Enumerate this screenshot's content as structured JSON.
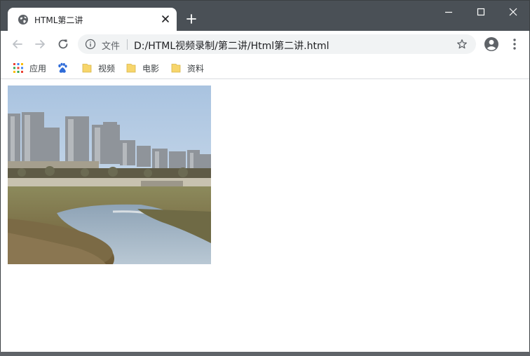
{
  "tab": {
    "title": "HTML第二讲",
    "favicon": "globe-icon"
  },
  "omnibox": {
    "info_chip": "文件",
    "url": "D:/HTML视频录制/第二讲/Html第二讲.html"
  },
  "bookmarks": [
    {
      "label": "应用",
      "icon": "apps-grid-icon"
    },
    {
      "label": "",
      "icon": "baidu-paw-icon"
    },
    {
      "label": "视频",
      "icon": "folder-icon"
    },
    {
      "label": "电影",
      "icon": "folder-icon"
    },
    {
      "label": "资料",
      "icon": "folder-icon"
    }
  ],
  "colors": {
    "tabstrip": "#4a5056",
    "omnibox_bg": "#f1f3f4",
    "folder": "#f7d56b",
    "text": "#202124"
  }
}
